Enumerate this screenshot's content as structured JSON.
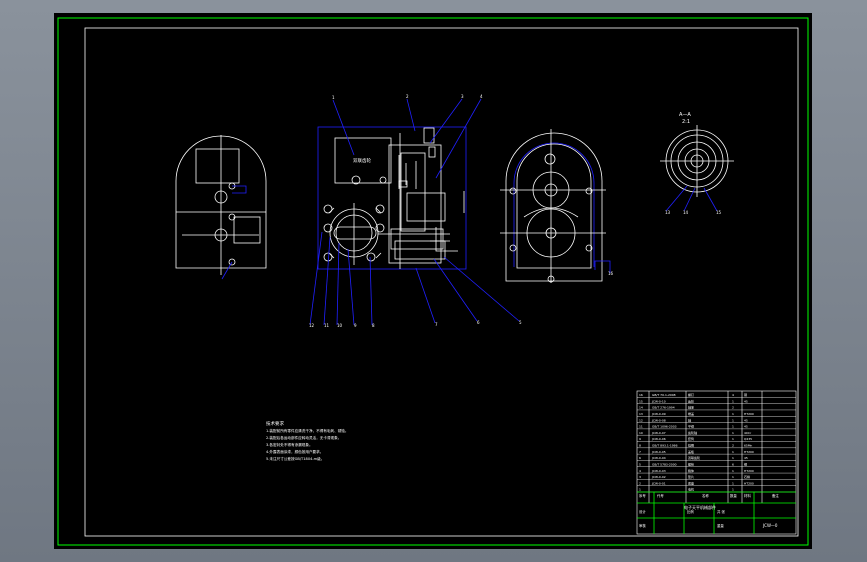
{
  "drawing": {
    "view_section_label": "A—A",
    "view_section_sub": "2:1",
    "component_label": "双联齿轮",
    "callouts": [
      "1",
      "2",
      "3",
      "4",
      "5",
      "6",
      "7",
      "8",
      "9",
      "10",
      "11",
      "12",
      "13",
      "14",
      "15",
      "16"
    ],
    "title": "电子天平机械部件",
    "drawing_number": "JCW—0",
    "notes": [
      "技术要求",
      "1.装配前所有零件应清洗干净，不得有毛刺、锈蚀。",
      "2.装配后各运动部件应转动灵活，无卡滞现象。",
      "3.各密封处不得有渗漏现象。",
      "4.外露表面涂漆，颜色按用户要求。",
      "5.未注尺寸公差按GB/T1804-m级。"
    ],
    "bom_rows": [
      [
        "16",
        "GB/T 70.1-2008",
        "螺钉",
        "4",
        "钢"
      ],
      [
        "15",
        "JCW-0-10",
        "齿轮",
        "1",
        "45"
      ],
      [
        "14",
        "GB/T 276-1994",
        "轴承",
        "2",
        ""
      ],
      [
        "13",
        "JCW-0-09",
        "端盖",
        "1",
        "HT200"
      ],
      [
        "12",
        "JCW-0-08",
        "轴",
        "1",
        "45"
      ],
      [
        "11",
        "GB/T 1096-2003",
        "平键",
        "1",
        "45"
      ],
      [
        "10",
        "JCW-0-07",
        "齿轮轴",
        "1",
        "40Cr"
      ],
      [
        "9",
        "JCW-0-06",
        "套筒",
        "1",
        "Q235"
      ],
      [
        "8",
        "GB/T 893.1-1986",
        "挡圈",
        "2",
        "65Mn"
      ],
      [
        "7",
        "JCW-0-05",
        "盖板",
        "1",
        "HT200"
      ],
      [
        "6",
        "JCW-0-04",
        "双联齿轮",
        "1",
        "45"
      ],
      [
        "5",
        "GB/T 5783-2000",
        "螺栓",
        "6",
        "钢"
      ],
      [
        "4",
        "JCW-0-03",
        "箱体",
        "1",
        "HT200"
      ],
      [
        "3",
        "JCW-0-02",
        "垫片",
        "1",
        "石棉"
      ],
      [
        "2",
        "JCW-0-01",
        "底座",
        "1",
        "HT200"
      ],
      [
        "1",
        "",
        "电机",
        "1",
        ""
      ]
    ],
    "title_block": {
      "seq_header": "序号",
      "code_header": "代号",
      "name_header": "名称",
      "qty_header": "数量",
      "mat_header": "材料",
      "remark_header": "备注",
      "design_label": "设计",
      "check_label": "审核",
      "scale_label": "比例",
      "sheet_label": "共 张",
      "weight_label": "重量"
    }
  },
  "colors": {
    "viewport": "#7d8590",
    "sheet": "#000000",
    "frame": "#00ff00",
    "geometry": "#ffffff",
    "leader": "#2020ff"
  }
}
